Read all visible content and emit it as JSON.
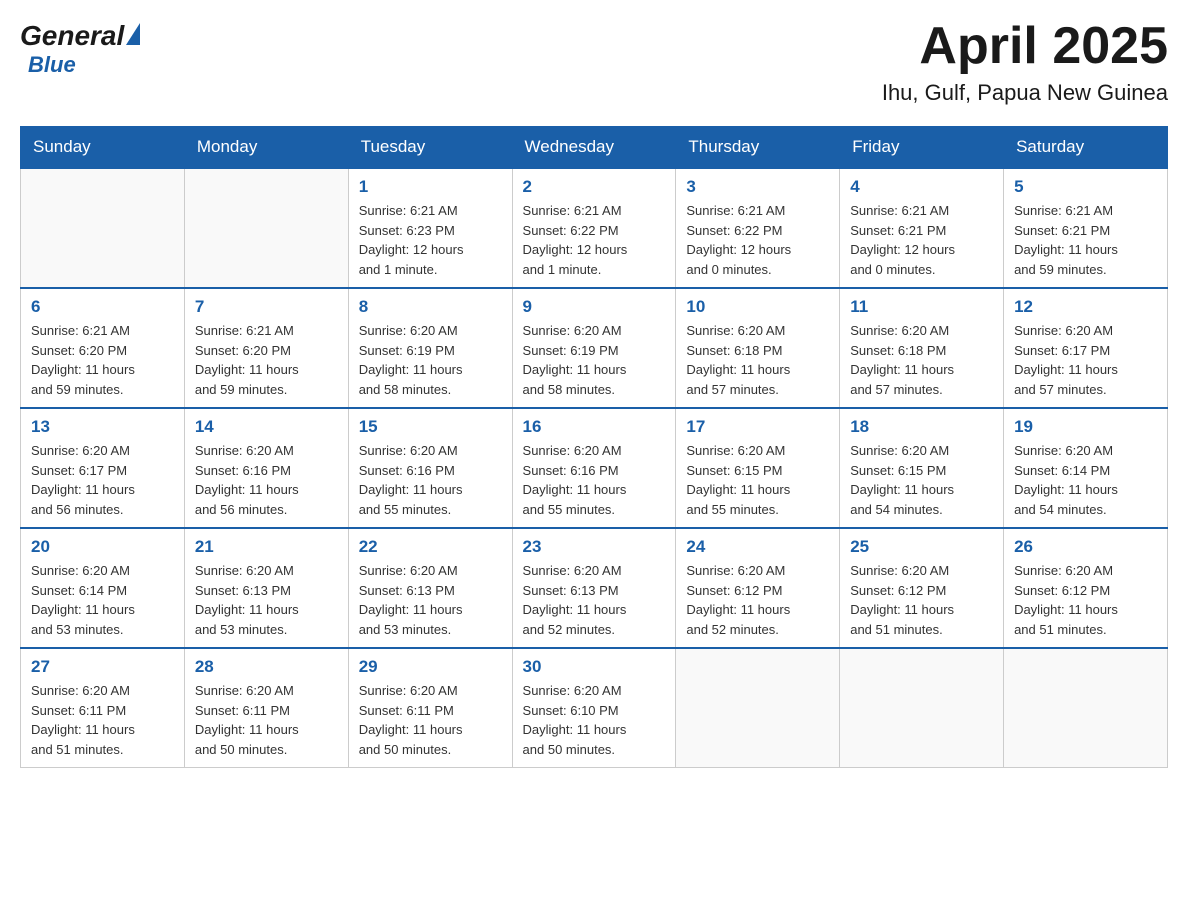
{
  "logo": {
    "general": "General",
    "blue": "Blue"
  },
  "title": "April 2025",
  "location": "Ihu, Gulf, Papua New Guinea",
  "days_of_week": [
    "Sunday",
    "Monday",
    "Tuesday",
    "Wednesday",
    "Thursday",
    "Friday",
    "Saturday"
  ],
  "weeks": [
    [
      {
        "day": "",
        "info": ""
      },
      {
        "day": "",
        "info": ""
      },
      {
        "day": "1",
        "info": "Sunrise: 6:21 AM\nSunset: 6:23 PM\nDaylight: 12 hours\nand 1 minute."
      },
      {
        "day": "2",
        "info": "Sunrise: 6:21 AM\nSunset: 6:22 PM\nDaylight: 12 hours\nand 1 minute."
      },
      {
        "day": "3",
        "info": "Sunrise: 6:21 AM\nSunset: 6:22 PM\nDaylight: 12 hours\nand 0 minutes."
      },
      {
        "day": "4",
        "info": "Sunrise: 6:21 AM\nSunset: 6:21 PM\nDaylight: 12 hours\nand 0 minutes."
      },
      {
        "day": "5",
        "info": "Sunrise: 6:21 AM\nSunset: 6:21 PM\nDaylight: 11 hours\nand 59 minutes."
      }
    ],
    [
      {
        "day": "6",
        "info": "Sunrise: 6:21 AM\nSunset: 6:20 PM\nDaylight: 11 hours\nand 59 minutes."
      },
      {
        "day": "7",
        "info": "Sunrise: 6:21 AM\nSunset: 6:20 PM\nDaylight: 11 hours\nand 59 minutes."
      },
      {
        "day": "8",
        "info": "Sunrise: 6:20 AM\nSunset: 6:19 PM\nDaylight: 11 hours\nand 58 minutes."
      },
      {
        "day": "9",
        "info": "Sunrise: 6:20 AM\nSunset: 6:19 PM\nDaylight: 11 hours\nand 58 minutes."
      },
      {
        "day": "10",
        "info": "Sunrise: 6:20 AM\nSunset: 6:18 PM\nDaylight: 11 hours\nand 57 minutes."
      },
      {
        "day": "11",
        "info": "Sunrise: 6:20 AM\nSunset: 6:18 PM\nDaylight: 11 hours\nand 57 minutes."
      },
      {
        "day": "12",
        "info": "Sunrise: 6:20 AM\nSunset: 6:17 PM\nDaylight: 11 hours\nand 57 minutes."
      }
    ],
    [
      {
        "day": "13",
        "info": "Sunrise: 6:20 AM\nSunset: 6:17 PM\nDaylight: 11 hours\nand 56 minutes."
      },
      {
        "day": "14",
        "info": "Sunrise: 6:20 AM\nSunset: 6:16 PM\nDaylight: 11 hours\nand 56 minutes."
      },
      {
        "day": "15",
        "info": "Sunrise: 6:20 AM\nSunset: 6:16 PM\nDaylight: 11 hours\nand 55 minutes."
      },
      {
        "day": "16",
        "info": "Sunrise: 6:20 AM\nSunset: 6:16 PM\nDaylight: 11 hours\nand 55 minutes."
      },
      {
        "day": "17",
        "info": "Sunrise: 6:20 AM\nSunset: 6:15 PM\nDaylight: 11 hours\nand 55 minutes."
      },
      {
        "day": "18",
        "info": "Sunrise: 6:20 AM\nSunset: 6:15 PM\nDaylight: 11 hours\nand 54 minutes."
      },
      {
        "day": "19",
        "info": "Sunrise: 6:20 AM\nSunset: 6:14 PM\nDaylight: 11 hours\nand 54 minutes."
      }
    ],
    [
      {
        "day": "20",
        "info": "Sunrise: 6:20 AM\nSunset: 6:14 PM\nDaylight: 11 hours\nand 53 minutes."
      },
      {
        "day": "21",
        "info": "Sunrise: 6:20 AM\nSunset: 6:13 PM\nDaylight: 11 hours\nand 53 minutes."
      },
      {
        "day": "22",
        "info": "Sunrise: 6:20 AM\nSunset: 6:13 PM\nDaylight: 11 hours\nand 53 minutes."
      },
      {
        "day": "23",
        "info": "Sunrise: 6:20 AM\nSunset: 6:13 PM\nDaylight: 11 hours\nand 52 minutes."
      },
      {
        "day": "24",
        "info": "Sunrise: 6:20 AM\nSunset: 6:12 PM\nDaylight: 11 hours\nand 52 minutes."
      },
      {
        "day": "25",
        "info": "Sunrise: 6:20 AM\nSunset: 6:12 PM\nDaylight: 11 hours\nand 51 minutes."
      },
      {
        "day": "26",
        "info": "Sunrise: 6:20 AM\nSunset: 6:12 PM\nDaylight: 11 hours\nand 51 minutes."
      }
    ],
    [
      {
        "day": "27",
        "info": "Sunrise: 6:20 AM\nSunset: 6:11 PM\nDaylight: 11 hours\nand 51 minutes."
      },
      {
        "day": "28",
        "info": "Sunrise: 6:20 AM\nSunset: 6:11 PM\nDaylight: 11 hours\nand 50 minutes."
      },
      {
        "day": "29",
        "info": "Sunrise: 6:20 AM\nSunset: 6:11 PM\nDaylight: 11 hours\nand 50 minutes."
      },
      {
        "day": "30",
        "info": "Sunrise: 6:20 AM\nSunset: 6:10 PM\nDaylight: 11 hours\nand 50 minutes."
      },
      {
        "day": "",
        "info": ""
      },
      {
        "day": "",
        "info": ""
      },
      {
        "day": "",
        "info": ""
      }
    ]
  ]
}
